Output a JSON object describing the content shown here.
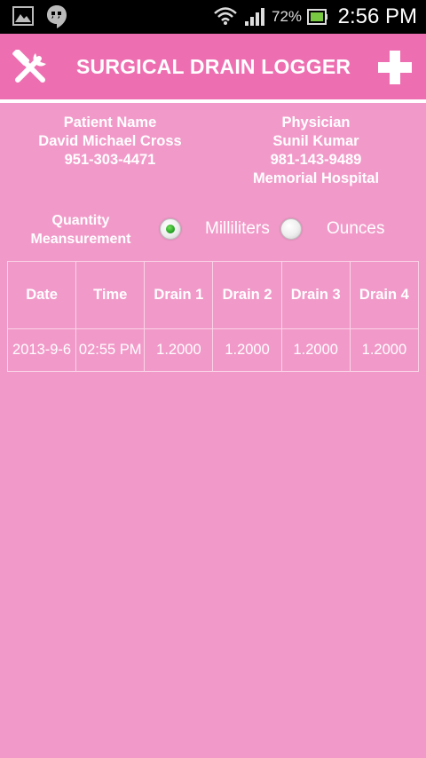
{
  "status_bar": {
    "battery_percent": "72%",
    "time": "2:56 PM",
    "icons": [
      "gallery-icon",
      "hangouts-icon",
      "wifi-icon",
      "signal-icon",
      "battery-icon"
    ]
  },
  "action_bar": {
    "title": "SURGICAL DRAIN LOGGER",
    "left_icon": "tools-icon",
    "right_icon": "add-icon",
    "background": "#ee6fb1"
  },
  "patient": {
    "heading": "Patient Name",
    "name": "David Michael Cross",
    "phone": "951-303-4471"
  },
  "physician": {
    "heading": "Physician",
    "name": "Sunil Kumar",
    "phone": "981-143-9489",
    "hospital": "Memorial Hospital"
  },
  "quantity": {
    "label_line1": "Quantity",
    "label_line2": "Meansurement",
    "options": [
      {
        "label": "Milliliters",
        "selected": true
      },
      {
        "label": "Ounces",
        "selected": false
      }
    ]
  },
  "table": {
    "headers": [
      "Date",
      "Time",
      "Drain 1",
      "Drain 2",
      "Drain 3",
      "Drain 4"
    ],
    "rows": [
      [
        "2013-9-6",
        "02:55 PM",
        "1.2000",
        "1.2000",
        "1.2000",
        "1.2000"
      ]
    ]
  },
  "colors": {
    "background": "#f19ac9",
    "accent": "#ee6fb1",
    "text": "#ffffff"
  }
}
